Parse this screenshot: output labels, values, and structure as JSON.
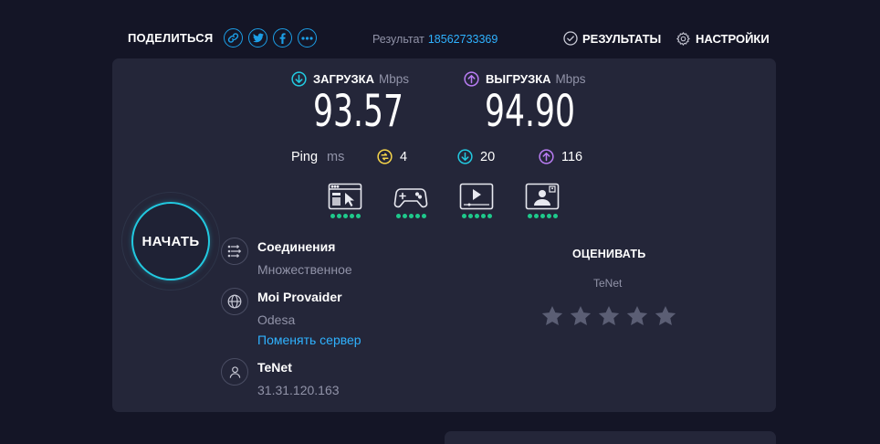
{
  "header": {
    "share_label": "ПОДЕЛИТЬСЯ",
    "result_label": "Результат",
    "result_id": "18562733369",
    "results_link": "РЕЗУЛЬТАТЫ",
    "settings_link": "НАСТРОЙКИ"
  },
  "speed": {
    "download_label": "ЗАГРУЗКА",
    "download_unit": "Mbps",
    "download_value": "93.57",
    "upload_label": "ВЫГРУЗКА",
    "upload_unit": "Mbps",
    "upload_value": "94.90"
  },
  "ping": {
    "label": "Ping",
    "unit": "ms",
    "jitter": "4",
    "download": "20",
    "upload": "116"
  },
  "ratings": [
    {
      "icon": "web-browsing-icon",
      "dots": 5
    },
    {
      "icon": "gaming-icon",
      "dots": 5
    },
    {
      "icon": "video-streaming-icon",
      "dots": 5
    },
    {
      "icon": "video-chat-icon",
      "dots": 5
    }
  ],
  "start_button": "НАЧАТЬ",
  "connection": {
    "title": "Соединения",
    "value": "Множественное"
  },
  "server": {
    "title": "Moi Provaider",
    "location": "Odesa",
    "change_link": "Поменять сервер"
  },
  "client": {
    "isp": "TeNet",
    "ip": "31.31.120.163"
  },
  "rate": {
    "title": "ОЦЕНИВАТЬ",
    "isp": "TeNet",
    "stars": 5
  },
  "colors": {
    "background": "#141526",
    "panel": "#242639",
    "accent_cyan": "#22c9e0",
    "accent_blue": "#2fb2ff",
    "upload_purple": "#b87cf2",
    "jitter_yellow": "#f5d44a",
    "good_green": "#1ec98b",
    "muted_text": "#9193a8"
  }
}
